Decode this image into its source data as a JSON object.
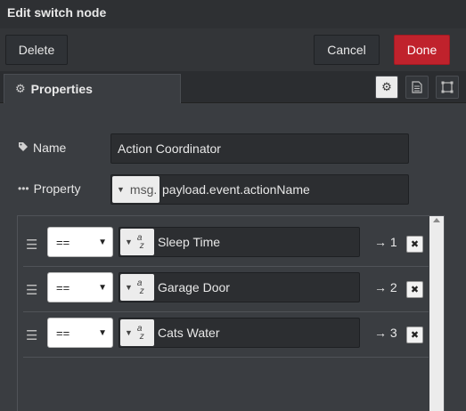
{
  "window": {
    "title": "Edit switch node"
  },
  "toolbar": {
    "delete_label": "Delete",
    "cancel_label": "Cancel",
    "done_label": "Done"
  },
  "tabs": {
    "properties_label": "Properties"
  },
  "form": {
    "name_label": "Name",
    "name_value": "Action Coordinator",
    "property_label": "Property",
    "property_type": "msg.",
    "property_value": "payload.event.actionName"
  },
  "rules": [
    {
      "operator": "==",
      "value_type": "string",
      "value": "Sleep Time",
      "output": "→ 1"
    },
    {
      "operator": "==",
      "value_type": "string",
      "value": "Garage Door",
      "output": "→ 2"
    },
    {
      "operator": "==",
      "value_type": "string",
      "value": "Cats Water",
      "output": "→ 3"
    }
  ],
  "colors": {
    "done_button": "#c0222c",
    "panel": "#3a3d41",
    "titlebar": "#2e3033"
  },
  "icons": [
    "gear-icon",
    "description-icon",
    "appearance-icon",
    "tag-icon",
    "ellipsis-icon",
    "drag-handle-icon",
    "remove-icon",
    "string-type-icon"
  ]
}
